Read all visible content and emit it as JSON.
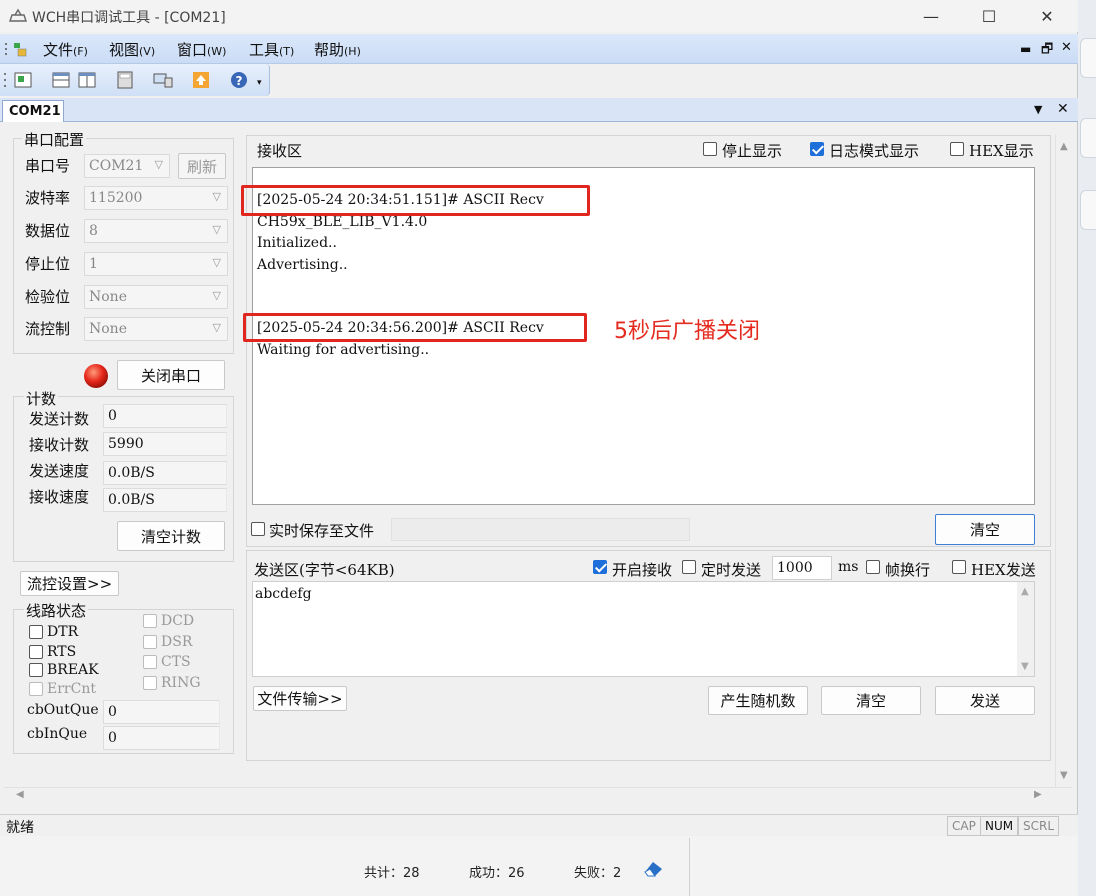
{
  "window": {
    "title": "WCH串口调试工具 - [COM21]",
    "minimize": "—",
    "maximize": "☐",
    "close": "✕"
  },
  "menu": {
    "items": [
      {
        "label": "文件",
        "key": "(F)"
      },
      {
        "label": "视图",
        "key": "(V)"
      },
      {
        "label": "窗口",
        "key": "(W)"
      },
      {
        "label": "工具",
        "key": "(T)"
      },
      {
        "label": "帮助",
        "key": "(H)"
      }
    ],
    "mdi_min": "▬",
    "mdi_restore": "🗗",
    "mdi_close": "✕"
  },
  "tabs": {
    "active": "COM21",
    "dropdown": "▼",
    "close": "✕"
  },
  "serial_config": {
    "group_title": "串口配置",
    "port_label": "串口号",
    "port_value": "COM21",
    "refresh_label": "刷新",
    "baud_label": "波特率",
    "baud_value": "115200",
    "databits_label": "数据位",
    "databits_value": "8",
    "stopbits_label": "停止位",
    "stopbits_value": "1",
    "parity_label": "检验位",
    "parity_value": "None",
    "flow_label": "流控制",
    "flow_value": "None",
    "close_port_label": "关闭串口"
  },
  "counters": {
    "group_title": "计数",
    "sent_label": "发送计数",
    "sent_value": "0",
    "recv_label": "接收计数",
    "recv_value": "5990",
    "send_speed_label": "发送速度",
    "send_speed_value": "0.0B/S",
    "recv_speed_label": "接收速度",
    "recv_speed_value": "0.0B/S",
    "clear_label": "清空计数"
  },
  "flow_settings_label": "流控设置>>",
  "line_state": {
    "group_title": "线路状态",
    "dtr": "DTR",
    "rts": "RTS",
    "break": "BREAK",
    "errcnt": "ErrCnt",
    "dcd": "DCD",
    "dsr": "DSR",
    "cts": "CTS",
    "ring": "RING",
    "outque_label": "cbOutQue",
    "outque_value": "0",
    "inque_label": "cbInQue",
    "inque_value": "0"
  },
  "receive": {
    "title": "接收区",
    "stop_display": "停止显示",
    "log_mode": "日志模式显示",
    "log_mode_checked": true,
    "hex_display": "HEX显示",
    "lines": [
      "[2025-05-24 20:34:51.151]# ASCII Recv",
      "CH59x_BLE_LIB_V1.4.0",
      "Initialized..",
      "Advertising..",
      "[2025-05-24 20:34:56.200]# ASCII Recv",
      "Waiting for advertising.."
    ],
    "annotation": "5秒后广播关闭",
    "save_to_file": "实时保存至文件",
    "clear_label": "清空"
  },
  "send": {
    "title": "发送区(字节<64KB)",
    "enable_recv": "开启接收",
    "enable_recv_checked": true,
    "timed_send": "定时发送",
    "interval_value": "1000",
    "interval_unit": "ms",
    "frame_newline": "帧换行",
    "hex_send": "HEX发送",
    "text": "abcdefg",
    "file_transfer": "文件传输>>",
    "random_label": "产生随机数",
    "clear_label": "清空",
    "send_label": "发送"
  },
  "statusbar": {
    "text": "就绪",
    "cap": "CAP",
    "num": "NUM",
    "scrl": "SCRL"
  },
  "lower_panel": {
    "total": "共计：28",
    "success": "成功：26",
    "failed": "失败：2"
  }
}
